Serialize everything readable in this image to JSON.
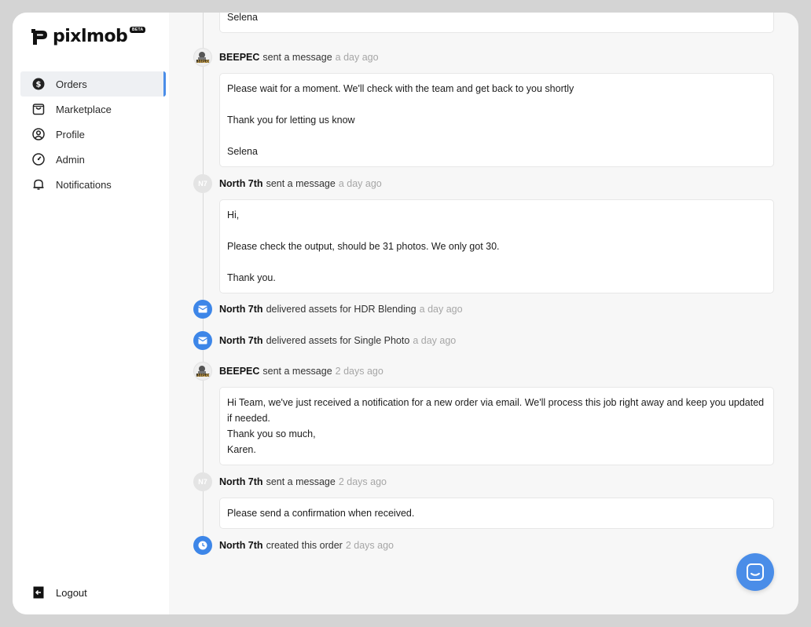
{
  "app": {
    "name": "pixlmob",
    "badge": "BETA"
  },
  "sidebar": {
    "items": [
      {
        "label": "Orders",
        "icon": "dollar-circle-icon",
        "active": true
      },
      {
        "label": "Marketplace",
        "icon": "shopping-bag-icon"
      },
      {
        "label": "Profile",
        "icon": "user-circle-icon"
      },
      {
        "label": "Admin",
        "icon": "gauge-icon"
      },
      {
        "label": "Notifications",
        "icon": "bell-icon"
      }
    ],
    "logout_label": "Logout"
  },
  "timeline": {
    "top_message": {
      "lines": [
        "Selena"
      ]
    },
    "events": [
      {
        "actor": "BEEPEC",
        "verb": "sent a message",
        "when": "a day ago",
        "avatar": "BEEPEC",
        "lines": [
          "Please wait for a moment. We'll check with the team and get back to you shortly",
          "",
          "Thank you for letting us know",
          "",
          "Selena"
        ]
      },
      {
        "actor": "North 7th",
        "verb": "sent a message",
        "when": "a day ago",
        "avatar": "N7",
        "lines": [
          "Hi,",
          "",
          "Please check the output, should be 31 photos. We only got 30.",
          "",
          "Thank you."
        ]
      },
      {
        "actor": "North 7th",
        "verb": "delivered assets for HDR Blending",
        "when": "a day ago",
        "avatar": "image-icon"
      },
      {
        "actor": "North 7th",
        "verb": "delivered assets for Single Photo",
        "when": "a day ago",
        "avatar": "image-icon"
      },
      {
        "actor": "BEEPEC",
        "verb": "sent a message",
        "when": "2 days ago",
        "avatar": "BEEPEC",
        "lines": [
          "Hi Team, we've just received a notification for a new order via  email. We'll process this job right away and keep you updated if needed.",
          "Thank you so much,",
          "Karen."
        ]
      },
      {
        "actor": "North 7th",
        "verb": "sent a message",
        "when": "2 days ago",
        "avatar": "N7",
        "lines": [
          "Please send a confirmation when received."
        ]
      },
      {
        "actor": "North 7th",
        "verb": "created this order",
        "when": "2 days ago",
        "avatar": "clock-icon"
      }
    ]
  },
  "colors": {
    "accent": "#4a8de8",
    "muted_text": "#a6a6a6",
    "background": "#f7f7f7"
  },
  "chat_widget_icon": "chat-icon"
}
